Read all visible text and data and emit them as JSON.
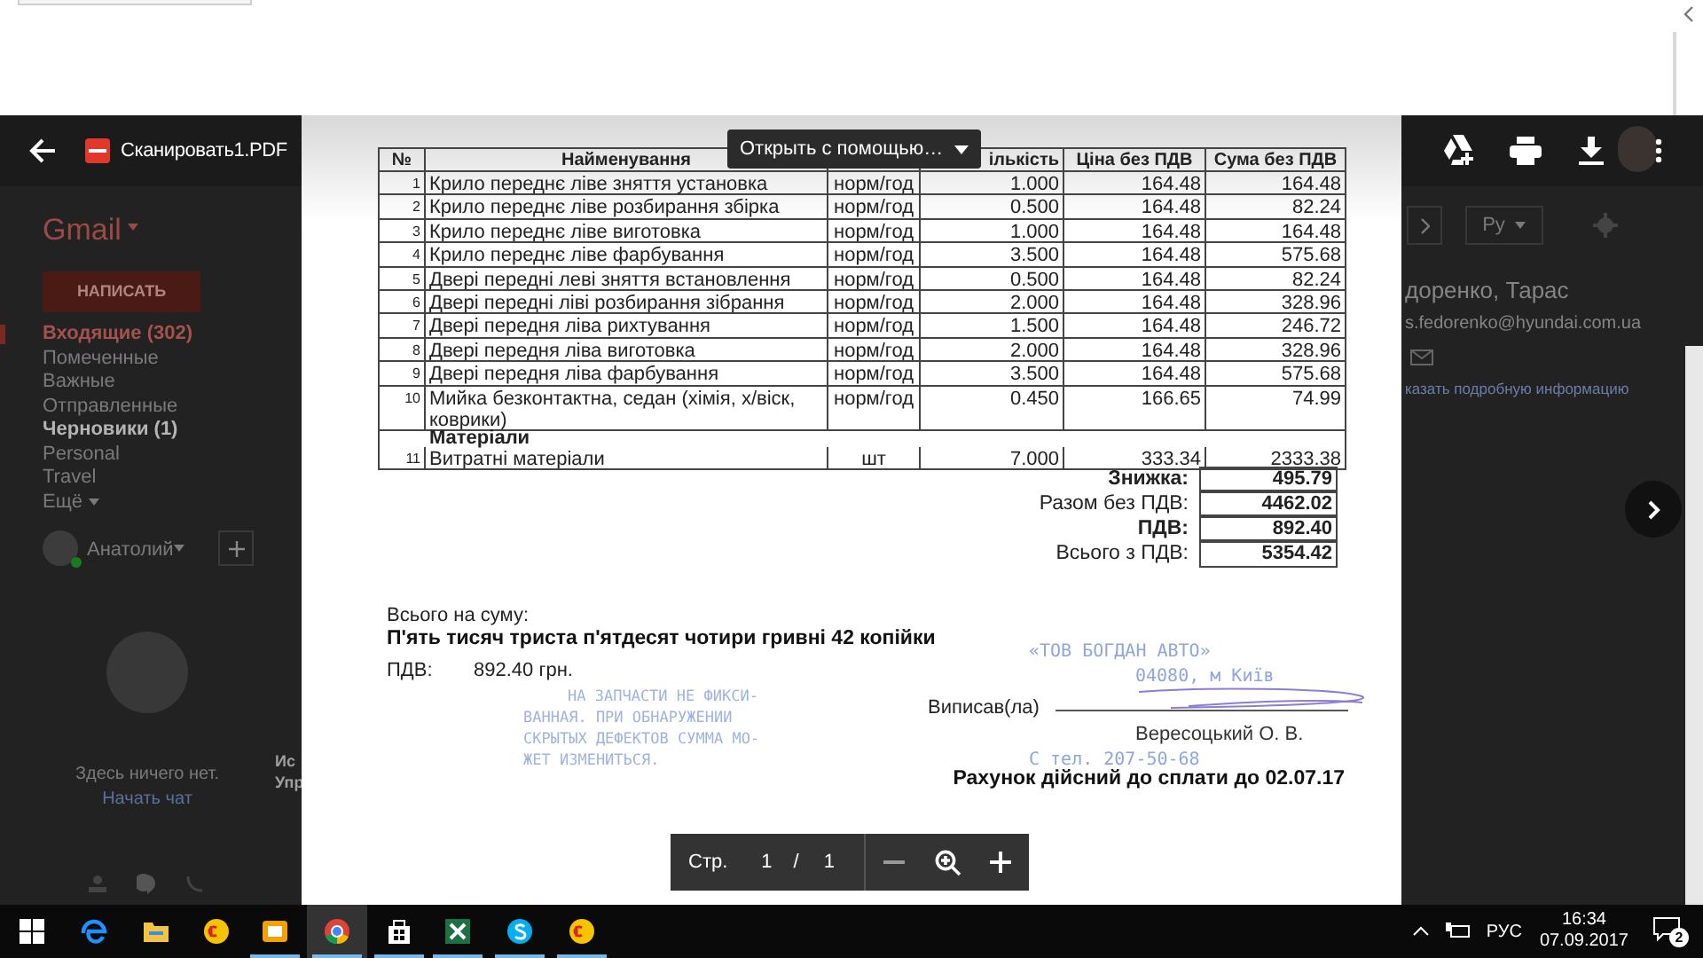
{
  "viewer": {
    "title": "Сканировать1.PDF",
    "open_with": "Открыть с помощью…"
  },
  "gmail": {
    "logo": "Gmail",
    "compose": "НАПИСАТЬ",
    "folders": [
      {
        "label": "Входящие (302)",
        "kind": "current"
      },
      {
        "label": "Помеченные",
        "kind": "plain"
      },
      {
        "label": "Важные",
        "kind": "plain"
      },
      {
        "label": "Отправленные",
        "kind": "plain"
      },
      {
        "label": "Черновики (1)",
        "kind": "bold"
      },
      {
        "label": "Personal",
        "kind": "plain"
      },
      {
        "label": "Travel",
        "kind": "plain"
      },
      {
        "label": "Ещё",
        "kind": "more"
      }
    ],
    "user": "Анатолий",
    "chat_empty": "Здесь ничего нет.",
    "start_chat": "Начать чат",
    "fragments": [
      "Ис",
      "Упр"
    ],
    "language": "Ру",
    "contact": {
      "name": "доренко, Тарас",
      "email": "s.fedorenko@hyundai.com.ua",
      "details": "казать подробную информацию"
    }
  },
  "table": {
    "columns": [
      "№",
      "Найменування",
      "ількість",
      "Ціна без ПДВ",
      "Сума без ПДВ"
    ],
    "rows": [
      {
        "kind": "item",
        "no": "1",
        "name": "Крило переднє ліве зняття установка",
        "unit": "норм/год",
        "qty": "1.000",
        "price": "164.48",
        "sum": "164.48"
      },
      {
        "kind": "item",
        "no": "2",
        "name": "Крило переднє ліве розбирання збірка",
        "unit": "норм/год",
        "qty": "0.500",
        "price": "164.48",
        "sum": "82.24"
      },
      {
        "kind": "item",
        "no": "3",
        "name": "Крило переднє ліве виготовка",
        "unit": "норм/год",
        "qty": "1.000",
        "price": "164.48",
        "sum": "164.48"
      },
      {
        "kind": "item",
        "no": "4",
        "name": "Крило переднє ліве фарбування",
        "unit": "норм/год",
        "qty": "3.500",
        "price": "164.48",
        "sum": "575.68"
      },
      {
        "kind": "item",
        "no": "5",
        "name": "Двері передні  леві зняття встановлення",
        "unit": "норм/год",
        "qty": "0.500",
        "price": "164.48",
        "sum": "82.24"
      },
      {
        "kind": "item",
        "no": "6",
        "name": "Двері передні  ліві розбирання зібрання",
        "unit": "норм/год",
        "qty": "2.000",
        "price": "164.48",
        "sum": "328.96"
      },
      {
        "kind": "item",
        "no": "7",
        "name": "Двері передня ліва рихтування",
        "unit": "норм/год",
        "qty": "1.500",
        "price": "164.48",
        "sum": "246.72"
      },
      {
        "kind": "item",
        "no": "8",
        "name": "Двері передня ліва виготовка",
        "unit": "норм/год",
        "qty": "2.000",
        "price": "164.48",
        "sum": "328.96"
      },
      {
        "kind": "item",
        "no": "9",
        "name": "Двері передня ліва фарбування",
        "unit": "норм/год",
        "qty": "3.500",
        "price": "164.48",
        "sum": "575.68"
      },
      {
        "kind": "item",
        "no": "10",
        "name": "Мийка безконтактна, седан (хімія, х/віск, коврики)",
        "unit": "норм/год",
        "qty": "0.450",
        "price": "166.65",
        "sum": "74.99"
      },
      {
        "kind": "section",
        "name": "Матеріали"
      },
      {
        "kind": "item",
        "no": "11",
        "name": "Витратні матеріали",
        "unit": "шт",
        "qty": "7.000",
        "price": "333.34",
        "sum": "2333.38"
      }
    ]
  },
  "totals": [
    {
      "label": "Знижка:",
      "value": "495.79"
    },
    {
      "label": "Разом без ПДВ:",
      "value": "4462.02"
    },
    {
      "label": "ПДВ:",
      "value": "892.40"
    },
    {
      "label": "Всього з ПДВ:",
      "value": "5354.42"
    }
  ],
  "amount": {
    "label": "Всього на суму:",
    "words": "П'ять тисяч триста п'ятдесят чотири гривні 42 копійки",
    "vat_label": "ПДВ:",
    "vat_value": "892.40 грн."
  },
  "stamp_left": [
    "НА ЗАПЧАСТИ НЕ ФИКСИ-",
    "ВАННАЯ. ПРИ ОБНАРУЖЕНИИ",
    "СКРЫТЫХ ДЕФЕКТОВ СУММА МО-",
    "ЖЕТ ИЗМЕНИТЬСЯ."
  ],
  "stamp_right": [
    "«ТОВ БОГДАН АВТО»",
    "04080, м Київ",
    "С тел. 207-50-68"
  ],
  "signature": {
    "label": "Виписав(ла)",
    "signer": "Вересоцький О. В."
  },
  "validity": "Рахунок дійсний до сплати до 02.07.17",
  "pager": {
    "label": "Стр.",
    "page": "1",
    "separator": "/",
    "total": "1"
  },
  "taskbar": {
    "apps": [
      {
        "kind": "edge",
        "running": false,
        "selected": false
      },
      {
        "kind": "folder",
        "running": false,
        "selected": false
      },
      {
        "kind": "onec",
        "running": false,
        "selected": false
      },
      {
        "kind": "mail",
        "running": true,
        "selected": false
      },
      {
        "kind": "chrome",
        "running": true,
        "selected": true
      },
      {
        "kind": "store",
        "running": true,
        "selected": false
      },
      {
        "kind": "excel",
        "running": true,
        "selected": false
      },
      {
        "kind": "skype",
        "running": true,
        "selected": false
      },
      {
        "kind": "onec",
        "running": true,
        "selected": false
      }
    ],
    "language": "РУС",
    "time": "16:34",
    "date": "07.09.2017",
    "notifications": "2"
  }
}
